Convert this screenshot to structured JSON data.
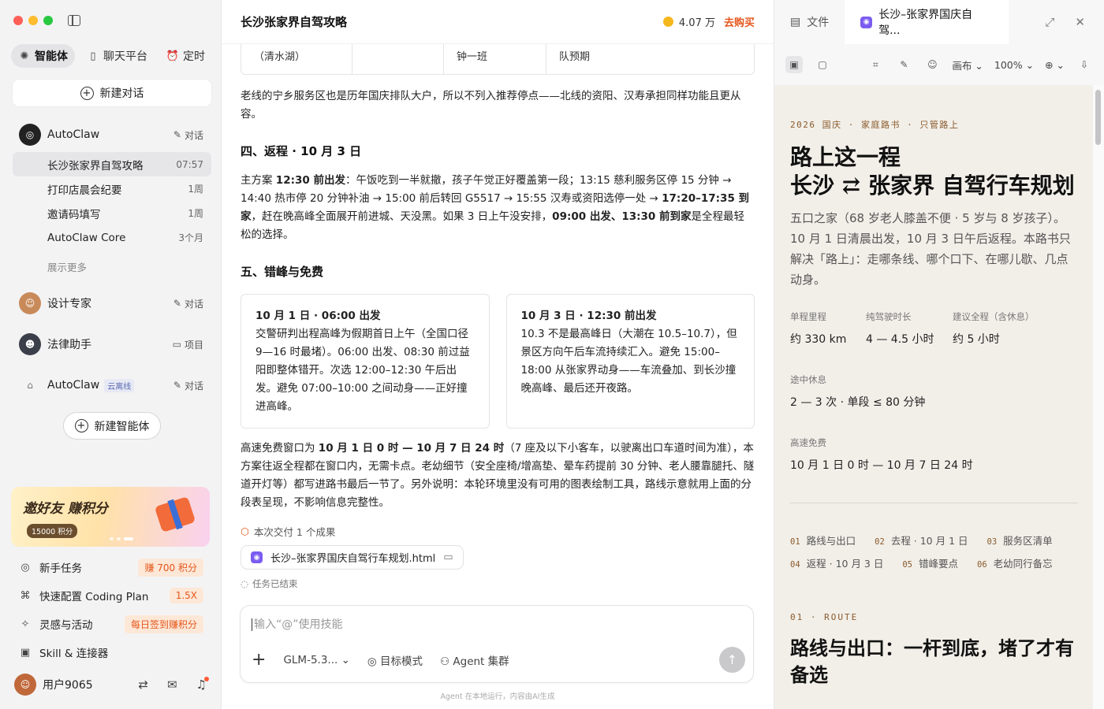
{
  "sidebar": {
    "nav": [
      "智能体",
      "聊天平台",
      "定时"
    ],
    "new_chat": "新建对话",
    "agents": [
      {
        "name": "AutoClaw",
        "action": "对话"
      },
      {
        "name": "设计专家",
        "action": "对话"
      },
      {
        "name": "法律助手",
        "action": "项目"
      },
      {
        "name": "AutoClaw",
        "badge": "云离线",
        "action": "对话"
      }
    ],
    "conversations": [
      {
        "title": "长沙张家界自驾攻略",
        "time": "07:57"
      },
      {
        "title": "打印店晨会纪要",
        "time": "1周"
      },
      {
        "title": "邀请码填写",
        "time": "1周"
      },
      {
        "title": "AutoClaw Core",
        "time": "3个月"
      }
    ],
    "show_more": "展示更多",
    "new_agent": "新建智能体",
    "banner": {
      "title": "邀好友 赚积分",
      "badge": "15000 积分"
    },
    "tasks": [
      {
        "label": "新手任务",
        "tag": "赚 700 积分"
      },
      {
        "label": "快速配置 Coding Plan",
        "tag": "1.5X"
      },
      {
        "label": "灵感与活动",
        "tag": "每日签到赚积分"
      },
      {
        "label": "Skill & 连接器",
        "tag": ""
      }
    ],
    "user": "用户9065"
  },
  "main": {
    "title": "长沙张家界自驾攻略",
    "credits": "4.07 万",
    "buy": "去购买",
    "table_cells": [
      "（清水湖）",
      "",
      "钟一班",
      "队预期"
    ],
    "para1": "老线的宁乡服务区也是历年国庆排队大户，所以不列入推荐停点——北线的资阳、汉寿承担同样功能且更从容。",
    "h4": "四、返程 · 10 月 3 日",
    "para2_a": "主方案 ",
    "para2_b": "12:30 前出发",
    "para2_c": "：午饭吃到一半就撤，孩子午觉正好覆盖第一段；13:15 慈利服务区停 15 分钟 → 14:40 热市停 20 分钟补油 → 15:00 前后转回 G5517 → 15:55 汉寿或资阳选停一处 → ",
    "para2_d": "17:20–17:35 到家",
    "para2_e": "，赶在晚高峰全面展开前进城、天没黑。如果 3 日上午没安排，",
    "para2_f": "09:00 出发、13:30 前到家",
    "para2_g": "是全程最轻松的选择。",
    "h5": "五、错峰与免费",
    "card1_title": "10 月 1 日 · 06:00 出发",
    "card1_body": "交警研判出程高峰为假期首日上午（全国口径 9—16 时最堵）。06:00 出发、08:30 前过益阳即整体错开。次选 12:00–12:30 午后出发。避免 07:00–10:00 之间动身——正好撞进高峰。",
    "card2_title": "10 月 3 日 · 12:30 前出发",
    "card2_body": "10.3 不是最高峰日（大潮在 10.5–10.7），但景区方向午后车流持续汇入。避免 15:00–18:00 从张家界动身——车流叠加、到长沙撞晚高峰、最后还开夜路。",
    "para3_a": "高速免费窗口为 ",
    "para3_b": "10 月 1 日 0 时 — 10 月 7 日 24 时",
    "para3_c": "（7 座及以下小客车，以驶离出口车道时间为准），本方案往返全程都在窗口内，无需卡点。老幼细节（安全座椅/增高垫、晕车药提前 30 分钟、老人腰靠腿托、隧道开灯等）都写进路书最后一节了。另外说明：本轮环境里没有可用的图表绘制工具，路线示意就用上面的分段表呈现，不影响信息完整性。",
    "delivery": "本次交付 1 个成果",
    "file": "长沙–张家界国庆自驾行车规划.html",
    "ended": "任务已结束",
    "input_placeholder": "输入“@”使用技能",
    "model": "GLM-5.3...",
    "goal_mode": "目标模式",
    "agent_cluster": "Agent 集群",
    "footer": "Agent 在本地运行，内容由AI生成"
  },
  "right": {
    "tab_files": "文件",
    "tab_doc": "长沙–张家界国庆自驾...",
    "canvas": "画布",
    "zoom": "100%",
    "kicker": "2026 国庆 · 家庭路书 · 只管路上",
    "title_line1": "路上这一程",
    "title_line2": "长沙 ⇄ 张家界 自驾行车规划",
    "intro": "五口之家（68 岁老人膝盖不便 · 5 岁与 8 岁孩子）。10 月 1 日清晨出发，10 月 3 日午后返程。本路书只解决「路上」：走哪条线、哪个口下、在哪儿歇、几点动身。",
    "stats": [
      {
        "k": "单程里程",
        "v": "约 330 km"
      },
      {
        "k": "纯驾驶时长",
        "v": "4 — 4.5 小时"
      },
      {
        "k": "建议全程（含休息）",
        "v": "约 5 小时"
      },
      {
        "k": "途中休息",
        "v": "2 — 3 次 · 单段 ≤ 80 分钟"
      },
      {
        "k": "高速免费",
        "v": "10 月 1 日 0 时 — 10 月 7 日 24 时"
      }
    ],
    "toc": [
      {
        "n": "01",
        "t": "路线与出口"
      },
      {
        "n": "02",
        "t": "去程 · 10 月 1 日"
      },
      {
        "n": "03",
        "t": "服务区清单"
      },
      {
        "n": "04",
        "t": "返程 · 10 月 3 日"
      },
      {
        "n": "05",
        "t": "错峰要点"
      },
      {
        "n": "06",
        "t": "老幼同行备忘"
      }
    ],
    "section_kicker": "01 · ROUTE",
    "section_title": "路线与出口：一杆到底，堵了才有备选"
  }
}
